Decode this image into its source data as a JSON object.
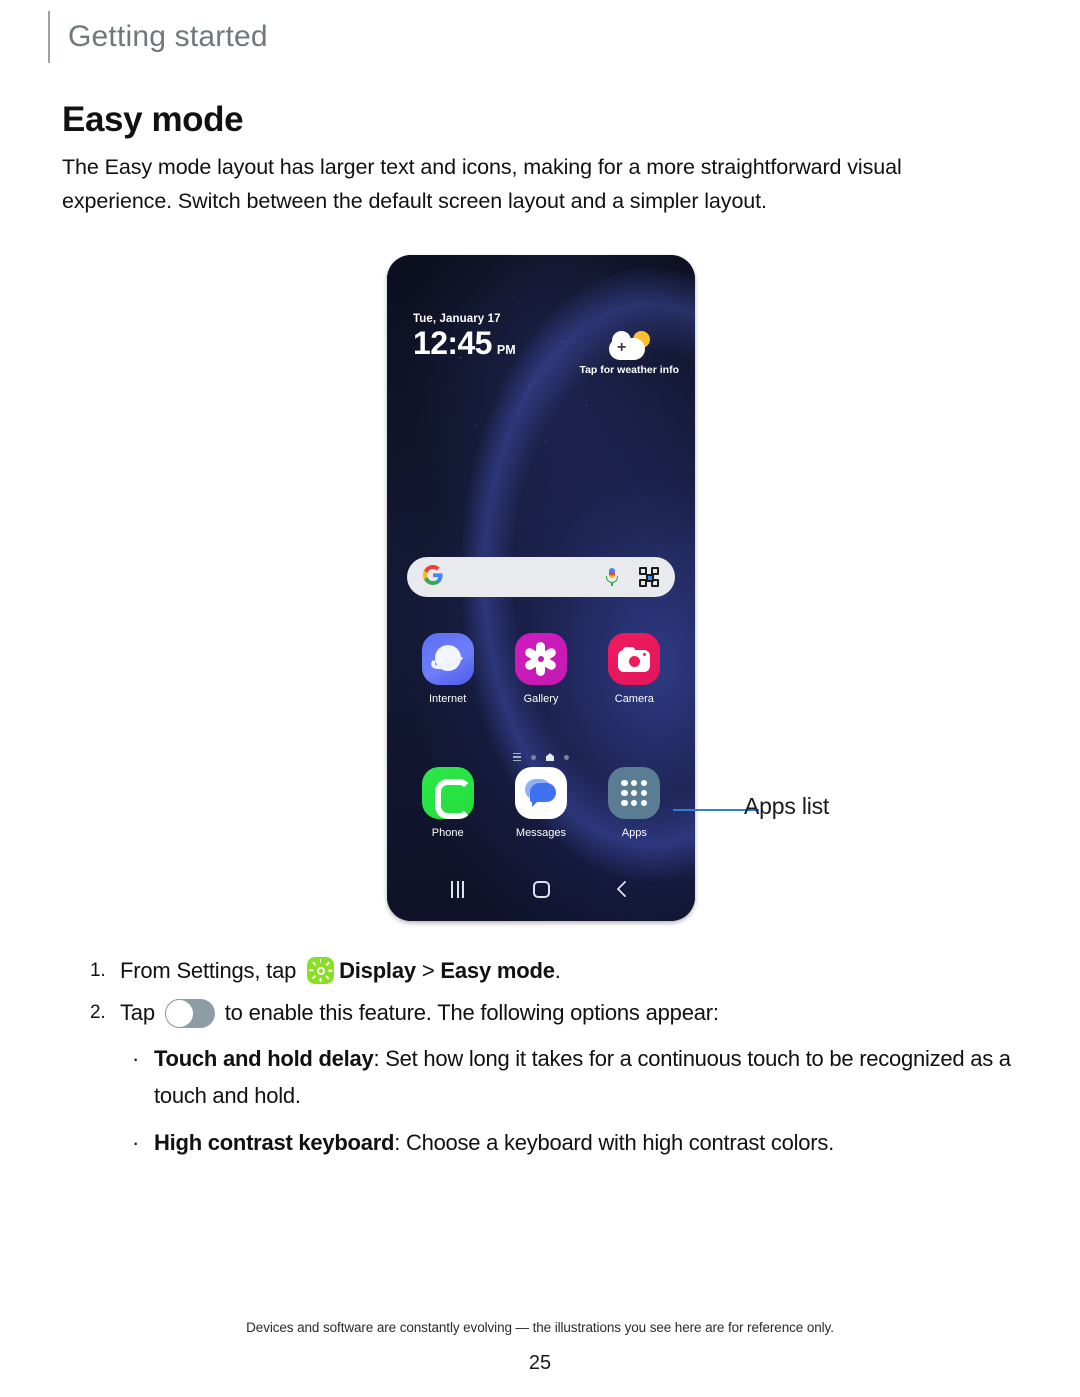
{
  "header": {
    "breadcrumb": "Getting started"
  },
  "section": {
    "title": "Easy mode",
    "intro": "The Easy mode layout has larger text and icons, making for a more straightforward visual experience. Switch between the default screen layout and a simpler layout."
  },
  "phone": {
    "lockscreen": {
      "date": "Tue, January 17",
      "time": "12:45",
      "ampm": "PM",
      "weather_hint": "Tap for weather info",
      "weather_icon": "cloud-plus-sun-icon"
    },
    "search": {
      "google_logo": "G",
      "mic_icon": "microphone-icon",
      "lens_icon": "google-lens-icon",
      "placeholder": ""
    },
    "apps_row_1": [
      {
        "label": "Internet",
        "icon": "internet-browser-icon"
      },
      {
        "label": "Gallery",
        "icon": "gallery-flower-icon"
      },
      {
        "label": "Camera",
        "icon": "camera-icon"
      }
    ],
    "apps_row_2": [
      {
        "label": "Phone",
        "icon": "phone-handset-icon"
      },
      {
        "label": "Messages",
        "icon": "messages-bubble-icon"
      },
      {
        "label": "Apps",
        "icon": "apps-grid-icon"
      }
    ],
    "page_indicator": {
      "items": [
        "list-lines-icon",
        "dot-icon",
        "home-active-icon",
        "dot-icon"
      ]
    },
    "navbar": {
      "recents": "recents-icon",
      "home": "home-icon",
      "back": "back-icon"
    }
  },
  "callout": {
    "label": "Apps list"
  },
  "steps": [
    {
      "number": "1.",
      "prefix": "From Settings, tap ",
      "icon": "display-brightness-icon",
      "bold_1": "Display",
      "separator": " > ",
      "bold_2": "Easy mode",
      "suffix": "."
    },
    {
      "number": "2.",
      "prefix": "Tap ",
      "icon": "toggle-switch-off",
      "suffix": " to enable this feature. The following options appear:"
    }
  ],
  "bullets": [
    {
      "marker": "·",
      "term": "Touch and hold delay",
      "description": ": Set how long it takes for a continuous touch to be recognized as a touch and hold."
    },
    {
      "marker": "·",
      "term": "High contrast keyboard",
      "description": ": Choose a keyboard with high contrast colors."
    }
  ],
  "footer": {
    "disclaimer": "Devices and software are constantly evolving — the illustrations you see here are for reference only.",
    "page_number": "25"
  },
  "colors": {
    "accent_blue": "#2f7ed8",
    "breadcrumb_gray": "#6f787c",
    "display_green": "#88e025",
    "toggle_gray": "#8e9da3",
    "phone_bg": "#0d1020"
  }
}
